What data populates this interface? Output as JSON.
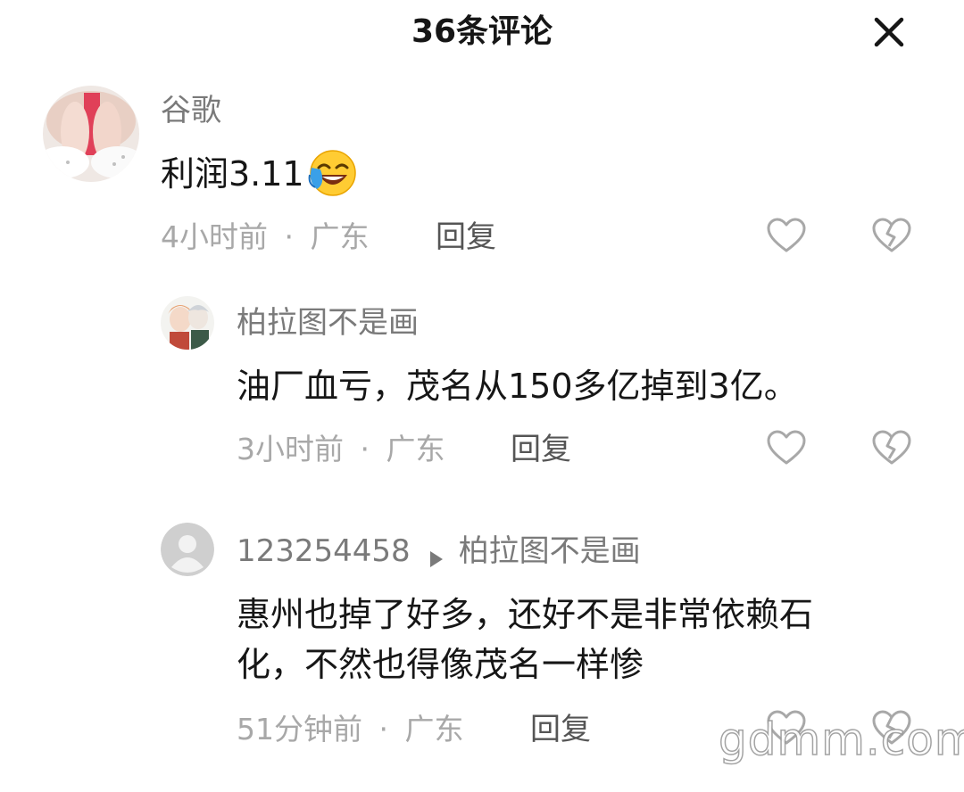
{
  "header": {
    "title": "36条评论"
  },
  "comments": [
    {
      "username": "谷歌",
      "content": "利润3.11",
      "emoji": "laugh-cry-emoji",
      "time": "4小时前",
      "separator": "·",
      "location": "广东",
      "reply_label": "回复"
    }
  ],
  "replies": [
    {
      "username": "柏拉图不是画",
      "content": "油厂血亏，茂名从150多亿掉到3亿。",
      "time": "3小时前",
      "separator": "·",
      "location": "广东",
      "reply_label": "回复"
    },
    {
      "username": "123254458",
      "reply_to": "柏拉图不是画",
      "content_line1": "惠州也掉了好多，还好不是非常依赖石",
      "content_line2": "化，不然也得像茂名一样惨",
      "time": "51分钟前",
      "separator": "·",
      "location": "广东",
      "reply_label": "回复"
    }
  ],
  "watermark": "gdmm.com",
  "colors": {
    "text": "#161616",
    "secondary": "#7a7a7a",
    "meta": "#a8a8a8"
  }
}
